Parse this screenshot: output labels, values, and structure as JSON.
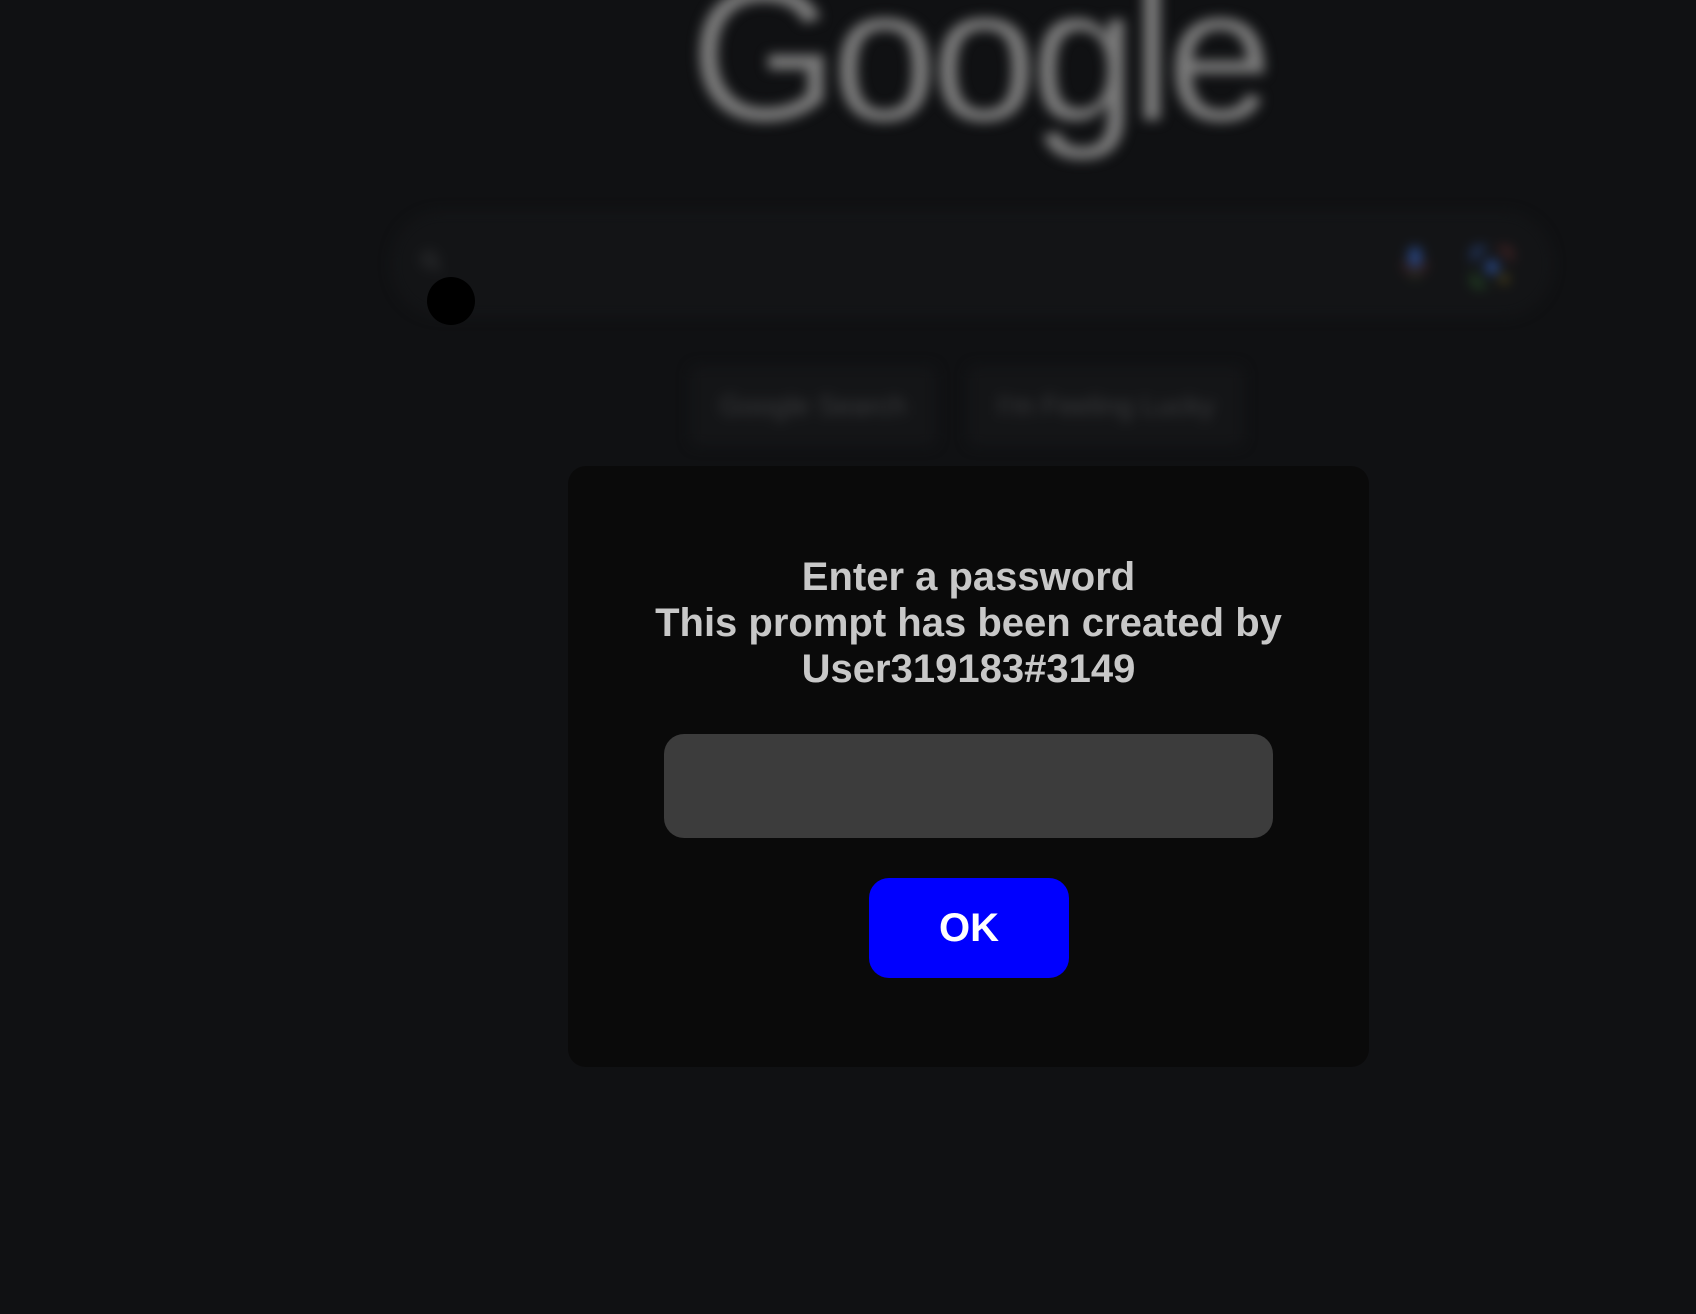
{
  "background": {
    "logo_text": "Google",
    "search_button_label": "Google Search",
    "lucky_button_label": "I'm Feeling Lucky"
  },
  "dialog": {
    "title_line1": "Enter a password",
    "title_line2": "This prompt has been created by",
    "title_line3": "User319183#3149",
    "password_value": "",
    "ok_label": "OK"
  },
  "colors": {
    "page_background": "#101113",
    "dialog_background": "#0a0a0a",
    "input_background": "#3c3c3c",
    "ok_button": "#0000ff",
    "title_text": "#c8c8c8"
  },
  "icons": {
    "search": "search-icon",
    "mic": "mic-icon",
    "lens": "lens-icon"
  }
}
